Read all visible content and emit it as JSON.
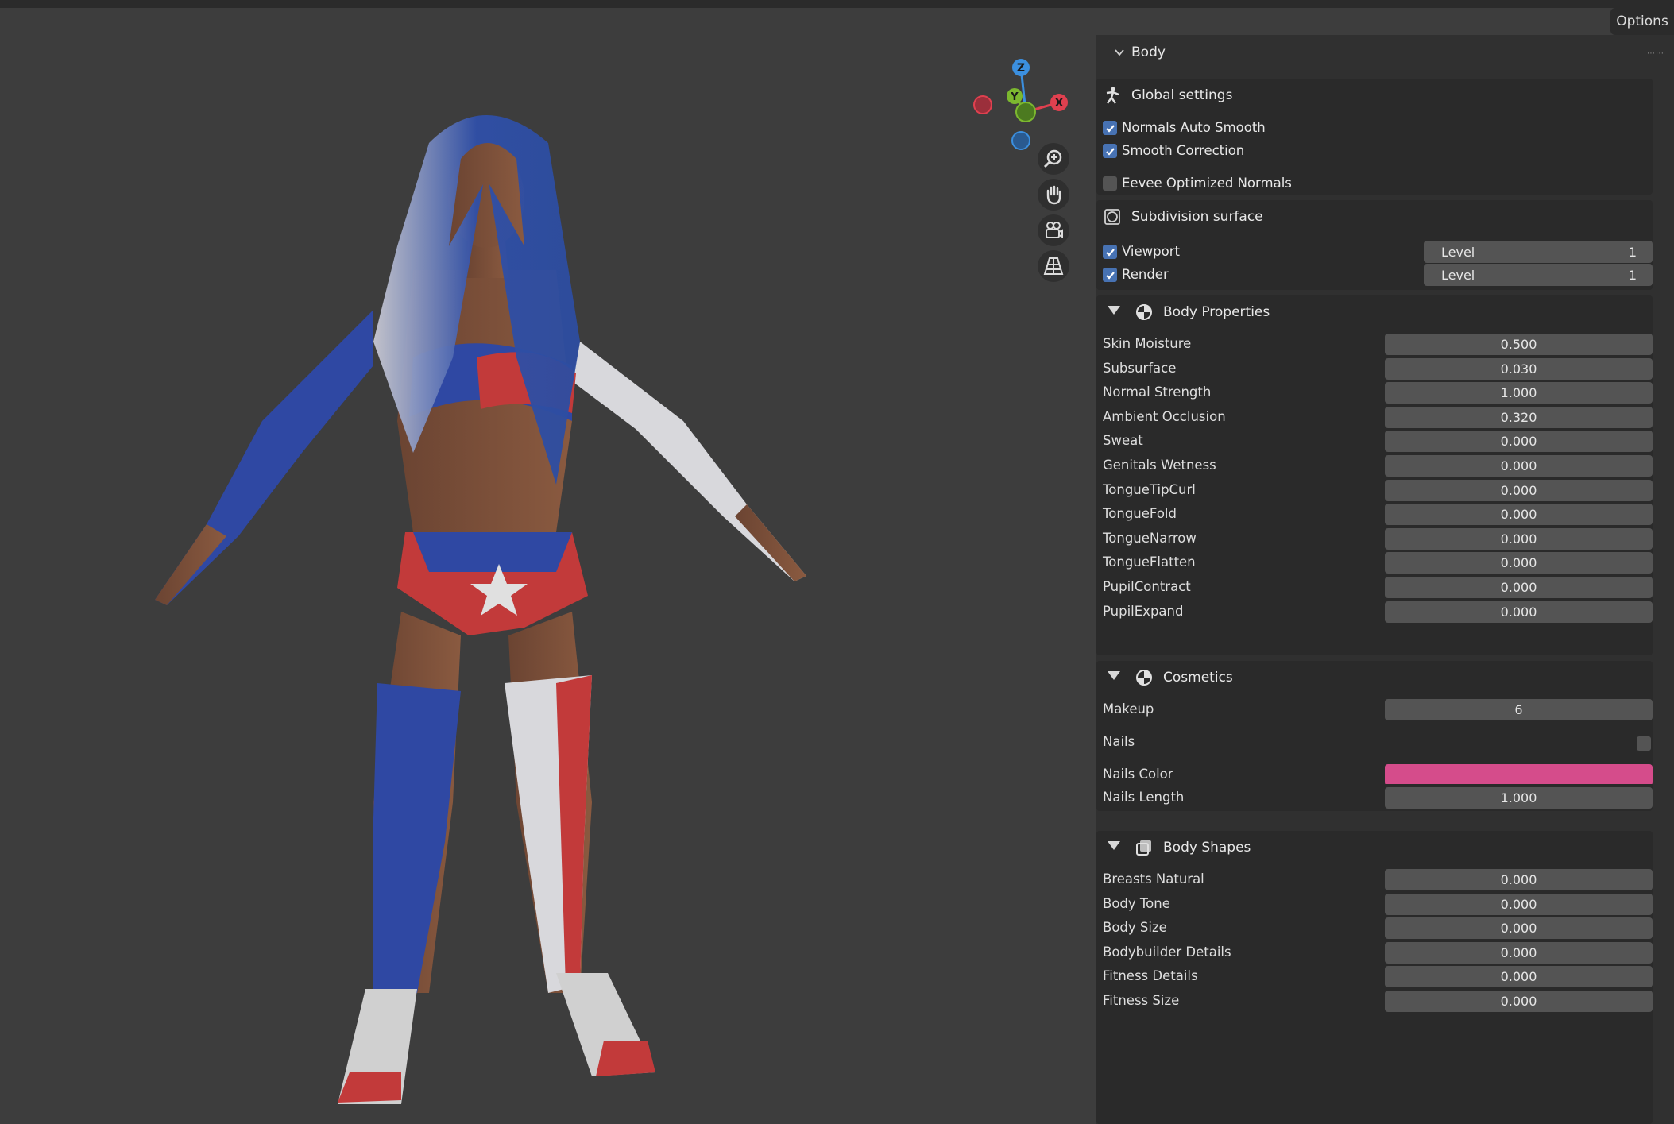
{
  "header": {
    "options_label": "Options"
  },
  "viewport": {
    "gizmo": {
      "z_label": "Z",
      "y_label": "Y",
      "x_label": "X"
    },
    "tools": [
      "zoom-icon",
      "hand-pan-icon",
      "camera-icon",
      "grid-perspective-icon"
    ]
  },
  "panel": {
    "title": "Body",
    "global": {
      "title": "Global settings",
      "normals_auto_smooth": "Normals Auto Smooth",
      "smooth_correction": "Smooth Correction",
      "eevee_optimized": "Eevee Optimized Normals"
    },
    "subdiv": {
      "title": "Subdivision surface",
      "viewport_label": "Viewport",
      "render_label": "Render",
      "level_label": "Level",
      "viewport_level": "1",
      "render_level": "1"
    },
    "body_properties": {
      "title": "Body Properties",
      "rows": [
        {
          "label": "Skin Moisture",
          "value": "0.500"
        },
        {
          "label": "Subsurface",
          "value": "0.030"
        },
        {
          "label": "Normal Strength",
          "value": "1.000"
        },
        {
          "label": "Ambient Occlusion",
          "value": "0.320"
        },
        {
          "label": "Sweat",
          "value": "0.000"
        },
        {
          "label": "Genitals Wetness",
          "value": "0.000"
        },
        {
          "label": "TongueTipCurl",
          "value": "0.000"
        },
        {
          "label": "TongueFold",
          "value": "0.000"
        },
        {
          "label": "TongueNarrow",
          "value": "0.000"
        },
        {
          "label": "TongueFlatten",
          "value": "0.000"
        },
        {
          "label": "PupilContract",
          "value": "0.000"
        },
        {
          "label": "PupilExpand",
          "value": "0.000"
        }
      ]
    },
    "cosmetics": {
      "title": "Cosmetics",
      "makeup_label": "Makeup",
      "makeup_value": "6",
      "nails_label": "Nails",
      "nails_color_label": "Nails Color",
      "nails_color": "#d54c8b",
      "nails_length_label": "Nails Length",
      "nails_length_value": "1.000"
    },
    "body_shapes": {
      "title": "Body Shapes",
      "rows": [
        {
          "label": "Breasts Natural",
          "value": "0.000"
        },
        {
          "label": "Body Tone",
          "value": "0.000"
        },
        {
          "label": "Body Size",
          "value": "0.000"
        },
        {
          "label": "Bodybuilder Details",
          "value": "0.000"
        },
        {
          "label": "Fitness Details",
          "value": "0.000"
        },
        {
          "label": "Fitness Size",
          "value": "0.000"
        }
      ]
    }
  },
  "colors": {
    "accent_blue": "#4772b3",
    "axis_x": "#e0404f",
    "axis_y": "#7cb82f",
    "axis_z": "#3b8fdf"
  }
}
